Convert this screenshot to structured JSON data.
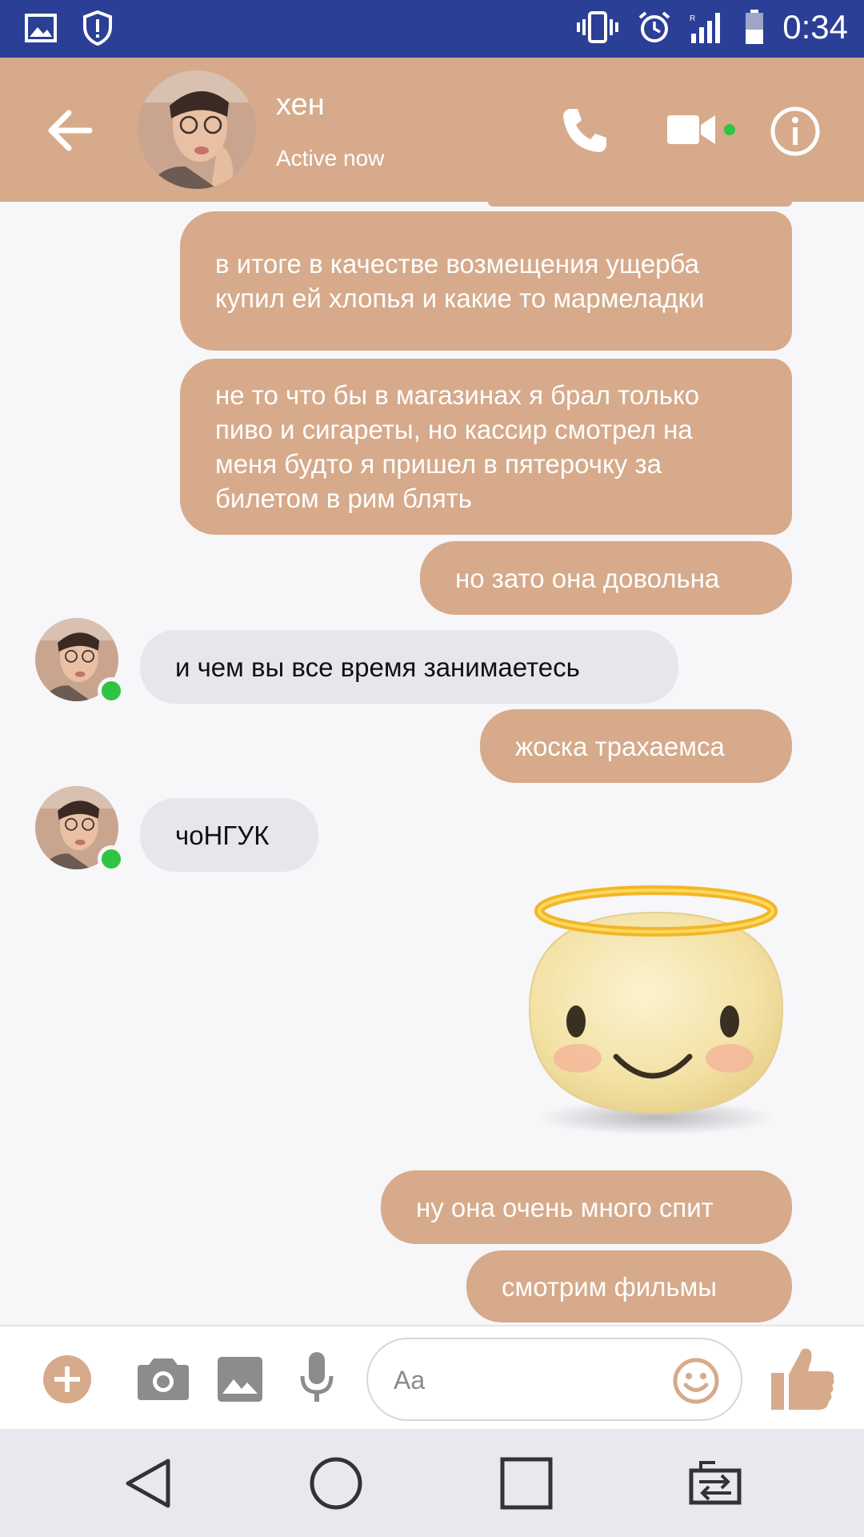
{
  "status_bar": {
    "time": "0:34"
  },
  "header": {
    "contact_name": "хен",
    "contact_status": "Active now"
  },
  "messages": [
    {
      "side": "out",
      "text": "в итоге в качестве возмещения ущерба купил ей хлопья и какие то мармеладки"
    },
    {
      "side": "out",
      "text": "не то что бы в магазинах я брал только пиво и сигареты, но кассир смотрел на меня будто я пришел в пятерочку за билетом в рим блять"
    },
    {
      "side": "out",
      "text": "но зато она довольна"
    },
    {
      "side": "in",
      "text": "и чем вы все время занимаетесь"
    },
    {
      "side": "out",
      "text": "жоска трахаемса"
    },
    {
      "side": "in",
      "text": "чоНГУК"
    },
    {
      "side": "out",
      "sticker": "angel-emoji"
    },
    {
      "side": "out",
      "text": "ну она очень много спит"
    },
    {
      "side": "out",
      "text": "смотрим фильмы"
    }
  ],
  "composer": {
    "placeholder": "Aa"
  },
  "colors": {
    "accent": "#d6aa8a",
    "status_bar": "#2c3f96",
    "online": "#2fc441",
    "incoming_bubble": "#e8e6eb"
  }
}
